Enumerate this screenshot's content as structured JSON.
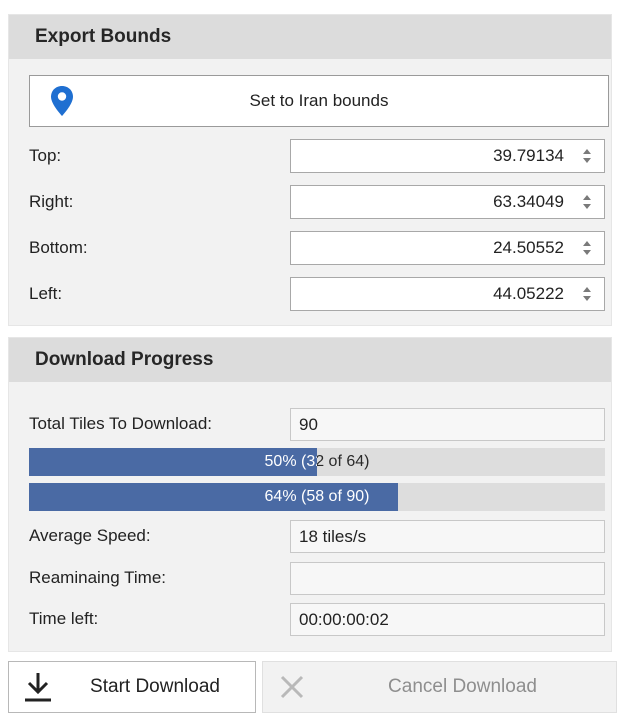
{
  "export_bounds": {
    "title": "Export Bounds",
    "set_button_label": "Set to Iran bounds",
    "fields": [
      {
        "label": "Top:",
        "value": "39.79134"
      },
      {
        "label": "Right:",
        "value": "63.34049"
      },
      {
        "label": "Bottom:",
        "value": "24.50552"
      },
      {
        "label": "Left:",
        "value": "44.05222"
      }
    ]
  },
  "download_progress": {
    "title": "Download Progress",
    "total_tiles_label": "Total Tiles To Download:",
    "total_tiles_value": "90",
    "bar1": {
      "text": "50% (32 of 64)",
      "fraction": 0.5
    },
    "bar2": {
      "text": "64% (58 of 90)",
      "fraction": 0.64
    },
    "avg_speed_label": "Average Speed:",
    "avg_speed_value": "18 tiles/s",
    "remaining_label": "Reaminaing Time:",
    "remaining_value": "",
    "time_left_label": "Time left:",
    "time_left_value": "00:00:00:02"
  },
  "actions": {
    "start_label": "Start Download",
    "cancel_label": "Cancel Download"
  },
  "icons": {
    "pin": "map-pin-icon",
    "download": "download-icon",
    "cancel": "close-icon"
  },
  "colors": {
    "accent": "#4a6aa4",
    "pin": "#1f6fd1"
  }
}
